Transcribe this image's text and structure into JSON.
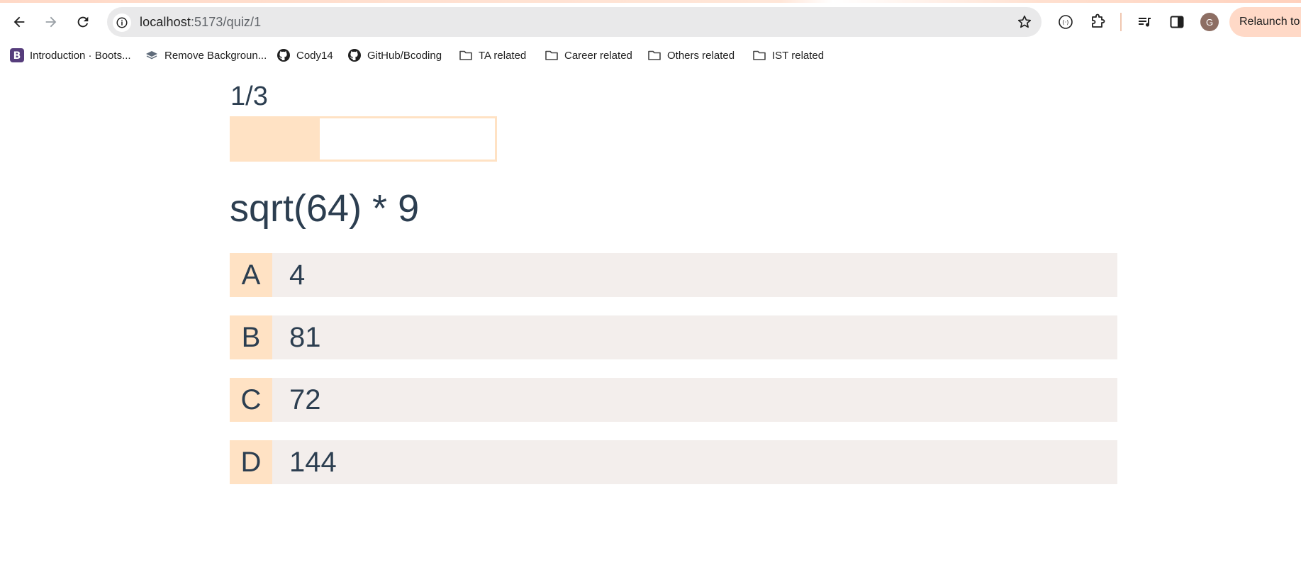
{
  "browser": {
    "url_host": "localhost",
    "url_path": ":5173/quiz/1",
    "avatar_initial": "G",
    "relaunch_label": "Relaunch to u"
  },
  "bookmarks": [
    {
      "label": "Introduction · Boots...",
      "icon": "bootstrap-icon"
    },
    {
      "label": "Remove Backgroun...",
      "icon": "layers-icon"
    },
    {
      "label": "Cody14",
      "icon": "github-icon"
    },
    {
      "label": "GitHub/Bcoding",
      "icon": "github-icon"
    },
    {
      "label": "TA related",
      "icon": "folder-icon"
    },
    {
      "label": "Career related",
      "icon": "folder-icon"
    },
    {
      "label": "Others related",
      "icon": "folder-icon"
    },
    {
      "label": "IST related",
      "icon": "folder-icon"
    }
  ],
  "quiz": {
    "progress_label": "1/3",
    "progress_fraction": 0.333,
    "question": "sqrt(64) * 9",
    "options": [
      {
        "letter": "A",
        "value": "4"
      },
      {
        "letter": "B",
        "value": "81"
      },
      {
        "letter": "C",
        "value": "72"
      },
      {
        "letter": "D",
        "value": "144"
      }
    ]
  },
  "colors": {
    "accent": "#ffe2c4",
    "option_bg": "#f3eeec",
    "text": "#2c3e50"
  }
}
